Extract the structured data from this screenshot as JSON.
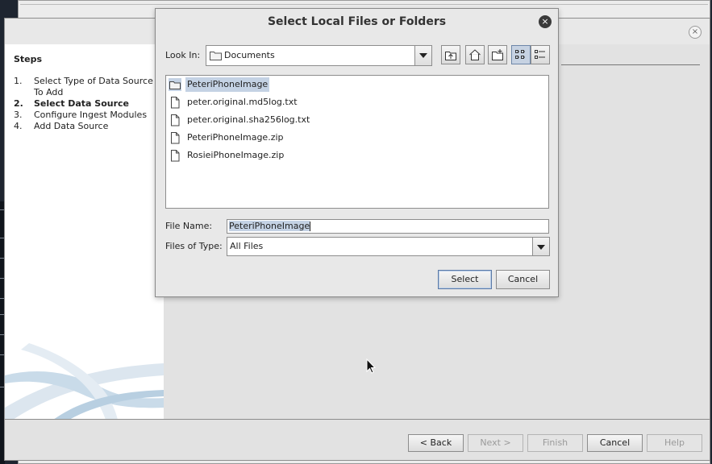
{
  "wizard": {
    "steps_title": "Steps",
    "steps": [
      {
        "num": "1.",
        "label": "Select Type of Data Source To Add",
        "active": false
      },
      {
        "num": "2.",
        "label": "Select Data Source",
        "active": true
      },
      {
        "num": "3.",
        "label": "Configure Ingest Modules",
        "active": false
      },
      {
        "num": "4.",
        "label": "Add Data Source",
        "active": false
      }
    ],
    "buttons": {
      "back": "< Back",
      "next": "Next >",
      "finish": "Finish",
      "cancel": "Cancel",
      "help": "Help"
    },
    "close_glyph": "×"
  },
  "dialog": {
    "title": "Select Local Files or Folders",
    "close_glyph": "×",
    "look_in_label": "Look In:",
    "look_in_value": "Documents",
    "files": [
      {
        "name": "PeteriPhoneImage",
        "type": "folder",
        "selected": true
      },
      {
        "name": "peter.original.md5log.txt",
        "type": "file",
        "selected": false
      },
      {
        "name": "peter.original.sha256log.txt",
        "type": "file",
        "selected": false
      },
      {
        "name": "PeteriPhoneImage.zip",
        "type": "file",
        "selected": false
      },
      {
        "name": "RosieiPhoneImage.zip",
        "type": "file",
        "selected": false
      }
    ],
    "file_name_label": "File Name:",
    "file_name_value": "PeteriPhoneImage",
    "files_of_type_label": "Files of Type:",
    "files_of_type_value": "All Files",
    "select_button": "Select",
    "cancel_button": "Cancel",
    "toolbar_icons": [
      "up-folder-icon",
      "home-icon",
      "new-folder-icon",
      "list-view-icon",
      "details-view-icon"
    ]
  },
  "colors": {
    "selection": "#c4d2e4",
    "dialog_bg": "#e8e8e8",
    "wizard_bg": "#e2e2e2"
  }
}
